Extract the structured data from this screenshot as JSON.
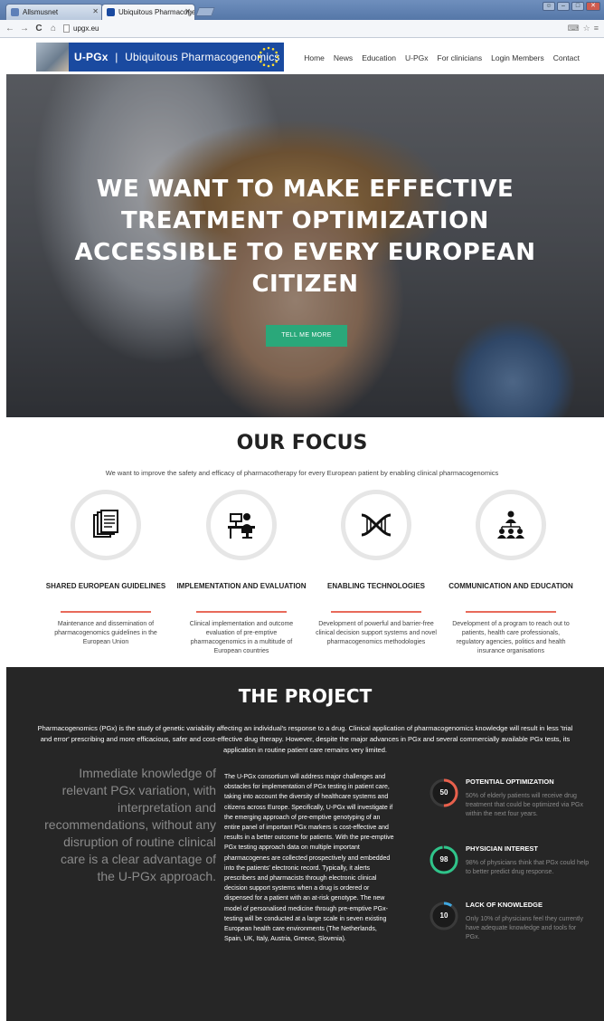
{
  "browser": {
    "tabs": [
      {
        "label": "Allsmusnet",
        "active": false
      },
      {
        "label": "Ubiquitous Pharmacoge...",
        "active": true
      }
    ],
    "url": "upgx.eu"
  },
  "header": {
    "logo_short": "U-PGx",
    "logo_sep": "|",
    "logo_name": "Ubiquitous  Pharmacogenomics",
    "nav": [
      "Home",
      "News",
      "Education",
      "U-PGx",
      "For clinicians",
      "Login Members",
      "Contact"
    ]
  },
  "hero": {
    "headline": "WE WANT TO MAKE EFFECTIVE TREATMENT OPTIMIZATION ACCESSIBLE TO EVERY EUROPEAN CITIZEN",
    "cta": "TELL ME MORE"
  },
  "focus": {
    "title": "OUR FOCUS",
    "intro": "We want to improve the safety and efficacy of pharmacotherapy for every European patient by enabling clinical pharmacogenomics",
    "accent_color": "#e86a5a",
    "items": [
      {
        "icon": "documents-icon",
        "title": "SHARED EUROPEAN GUIDELINES",
        "desc": "Maintenance and dissemination of pharmacogenomics guidelines in the European Union"
      },
      {
        "icon": "clinician-desk-icon",
        "title": "IMPLEMENTATION AND EVALUATION",
        "desc": "Clinical implementation and outcome evaluation of pre-emptive pharmacogenomics in a multitude of European countries"
      },
      {
        "icon": "dna-icon",
        "title": "ENABLING TECHNOLOGIES",
        "desc": "Development of powerful and barrier-free clinical decision support systems and novel pharmacogenomics methodologies"
      },
      {
        "icon": "network-people-icon",
        "title": "COMMUNICATION AND EDUCATION",
        "desc": "Development of a program to reach out to patients, health care professionals, regulatory agencies, politics and health insurance organisations"
      }
    ]
  },
  "project": {
    "title": "THE PROJECT",
    "lead": "Pharmacogenomics (PGx) is the study of genetic variability affecting an individual's response to a drug. Clinical application of pharmacogenomics knowledge will result in less 'trial and error' prescribing and more efficacious, safer and cost-effective drug therapy. However, despite the major advances in PGx and several commercially available PGx tests, its application in routine patient care remains very limited.",
    "quote": "Immediate knowledge of relevant PGx variation, with interpretation and recommendations, without any disruption of routine clinical care is a clear advantage of the U-PGx approach.",
    "body": "The U-PGx consortium will address major challenges and obstacles for implementation of PGx testing in patient care, taking into account the diversity of healthcare systems and citizens across Europe. Specifically, U-PGx will investigate if the emerging approach of pre-emptive genotyping of an entire panel of important PGx markers is cost-effective and results in a better outcome for patients. With the pre-emptive PGx testing approach data on multiple important pharmacogenes are collected prospectively and embedded into the patients' electronic record. Typically, it alerts prescribers and pharmacists through electronic clinical decision support systems when a drug is ordered or dispensed for a patient with an at-risk genotype. The new model of personalised medicine through pre-emptive PGx-testing will be conducted at a large scale in seven existing European health care environments (The Netherlands, Spain, UK, Italy, Austria, Greece, Slovenia).",
    "stats": [
      {
        "value": "50",
        "percent": 50,
        "color": "#e8604c",
        "title": "POTENTIAL OPTIMIZATION",
        "desc": "50% of elderly patients will receive drug treatment that could be optimized via PGx within the next four years."
      },
      {
        "value": "98",
        "percent": 98,
        "color": "#2fc48a",
        "title": "PHYSICIAN INTEREST",
        "desc": "98% of physicians think that PGx could help to better predict drug response."
      },
      {
        "value": "10",
        "percent": 10,
        "color": "#3fa7e0",
        "title": "LACK OF KNOWLEDGE",
        "desc": "Only 10% of physicians feel they currently have adequate knowledge and tools for PGx."
      }
    ]
  }
}
